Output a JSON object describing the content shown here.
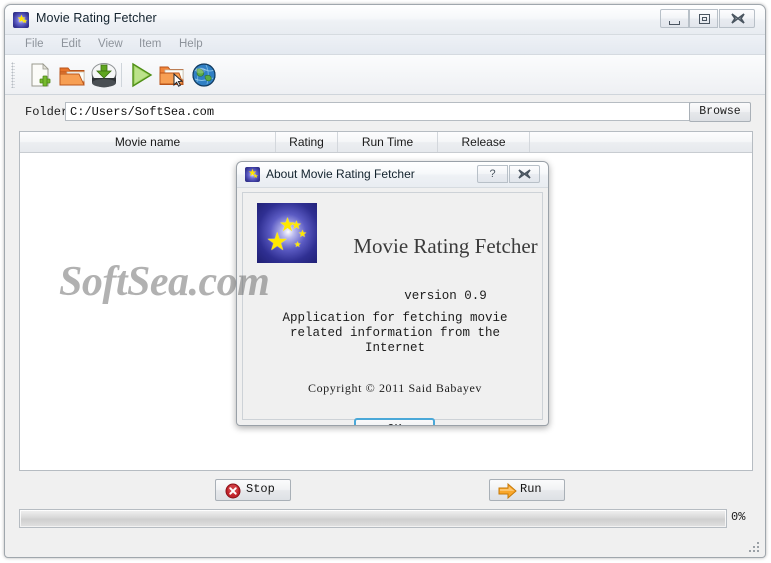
{
  "window": {
    "title": "Movie Rating Fetcher",
    "icon": "app-star-icon",
    "controls": {
      "minimize": "minimize-icon",
      "maximize": "maximize-icon",
      "close": "✖"
    }
  },
  "menu": {
    "items": [
      {
        "label": "File"
      },
      {
        "label": "Edit"
      },
      {
        "label": "View"
      },
      {
        "label": "Item"
      },
      {
        "label": "Help"
      }
    ]
  },
  "toolbar": {
    "buttons": [
      {
        "name": "new-document-icon",
        "tip": "New"
      },
      {
        "name": "open-folder-icon",
        "tip": "Open"
      },
      {
        "name": "save-disk-icon",
        "tip": "Save"
      },
      {
        "name": "run-play-icon",
        "tip": "Run"
      },
      {
        "name": "browse-folder-icon",
        "tip": "Browse"
      },
      {
        "name": "globe-icon",
        "tip": "Internet"
      }
    ]
  },
  "folder": {
    "label": "Folder",
    "value": "C:/Users/SoftSea.com",
    "placeholder": "",
    "browse_label": "Browse"
  },
  "table": {
    "columns": [
      {
        "label": "Movie name"
      },
      {
        "label": "Rating"
      },
      {
        "label": "Run Time"
      },
      {
        "label": "Release"
      }
    ],
    "rows": []
  },
  "actions": {
    "stop_label": "Stop",
    "run_label": "Run"
  },
  "progress": {
    "percent_label": "0%",
    "value": 0
  },
  "about_dialog": {
    "title": "About Movie Rating Fetcher",
    "help_glyph": "?",
    "close_glyph": "✖",
    "app_title": "Movie Rating Fetcher",
    "version": "version 0.9",
    "description": "Application for fetching movie related information from the Internet",
    "copyright": "Copyright © 2011 Said Babayev",
    "ok_label": "OK"
  },
  "watermark": {
    "text": "SoftSea.com"
  },
  "colors": {
    "accent_blue": "#4aa8d8",
    "logo_blue": "#2f2f92",
    "star_yellow": "#ffe800",
    "stop_red": "#c0232a",
    "run_orange": "#f29a1e",
    "play_green": "#6cb82a"
  }
}
